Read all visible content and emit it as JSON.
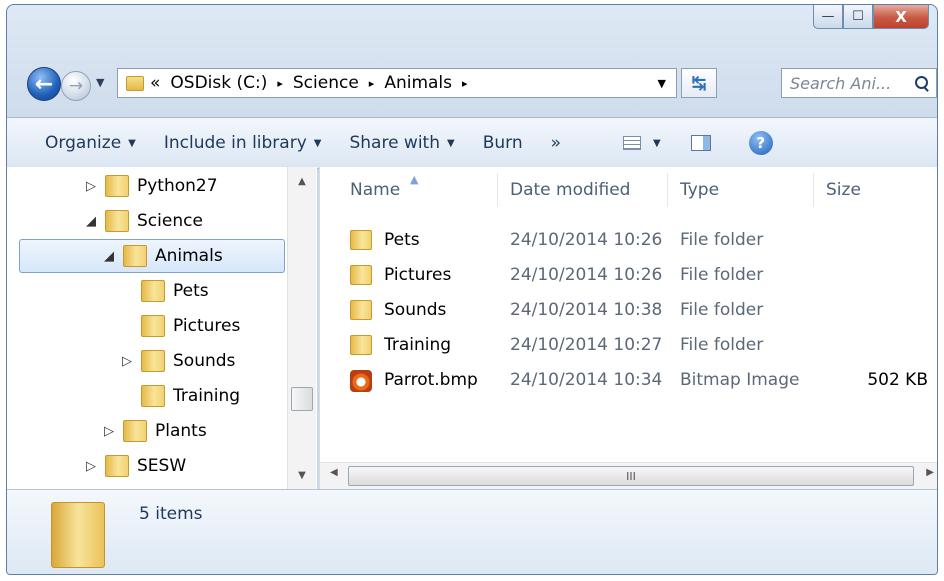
{
  "window": {
    "caption_buttons": {
      "minimize": "—",
      "maximize": "☐",
      "close": "X"
    }
  },
  "nav": {
    "address": {
      "overflow": "«",
      "crumbs": [
        "OSDisk (C:)",
        "Science",
        "Animals"
      ],
      "separator": "▸"
    },
    "search": {
      "placeholder": "Search Ani..."
    }
  },
  "toolbar": {
    "organize": "Organize",
    "include": "Include in library",
    "share": "Share with",
    "burn": "Burn",
    "more": "»"
  },
  "tree": {
    "items": [
      {
        "label": "Python27",
        "expander": "▷"
      },
      {
        "label": "Science",
        "expander": "◢"
      },
      {
        "label": "Animals",
        "expander": "◢",
        "selected": true
      },
      {
        "label": "Pets",
        "expander": ""
      },
      {
        "label": "Pictures",
        "expander": ""
      },
      {
        "label": "Sounds",
        "expander": "▷"
      },
      {
        "label": "Training",
        "expander": ""
      },
      {
        "label": "Plants",
        "expander": "▷"
      },
      {
        "label": "SESW",
        "expander": "▷"
      }
    ]
  },
  "columns": {
    "name": "Name",
    "date": "Date modified",
    "type": "Type",
    "size": "Size"
  },
  "files": [
    {
      "name": "Pets",
      "date": "24/10/2014 10:26",
      "type": "File folder",
      "size": "",
      "icon": "folder-icon"
    },
    {
      "name": "Pictures",
      "date": "24/10/2014 10:26",
      "type": "File folder",
      "size": "",
      "icon": "folder-icon"
    },
    {
      "name": "Sounds",
      "date": "24/10/2014 10:38",
      "type": "File folder",
      "size": "",
      "icon": "folder-icon"
    },
    {
      "name": "Training",
      "date": "24/10/2014 10:27",
      "type": "File folder",
      "size": "",
      "icon": "folder-icon"
    },
    {
      "name": "Parrot.bmp",
      "date": "24/10/2014 10:34",
      "type": "Bitmap Image",
      "size": "502 KB",
      "icon": "bitmap-icon"
    }
  ],
  "hscroll": {
    "grip": "III"
  },
  "details": {
    "count": "5 items"
  }
}
